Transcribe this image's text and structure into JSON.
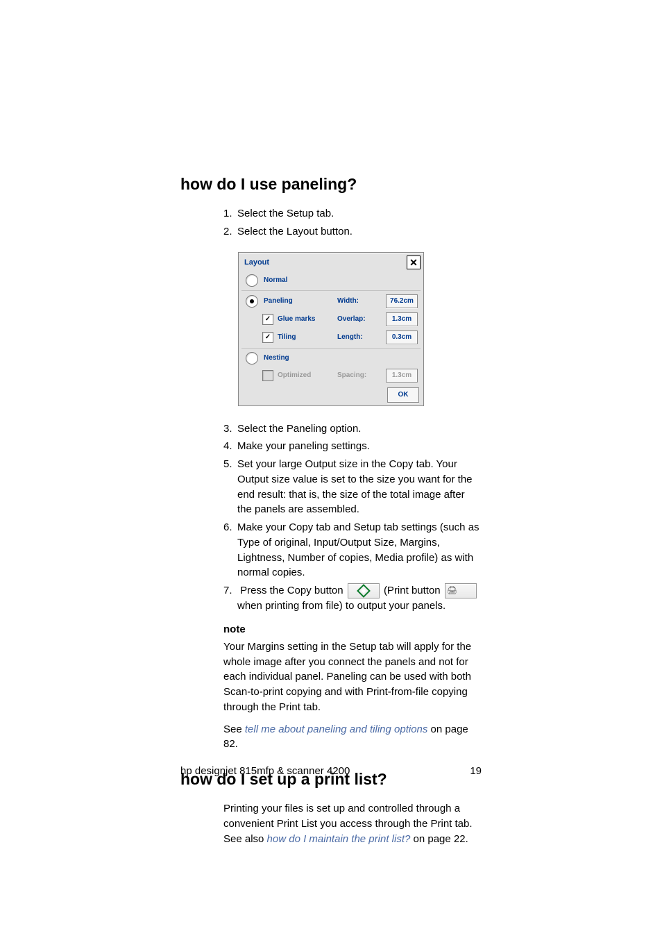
{
  "headings": {
    "h1": "how do I use paneling?",
    "h2": "how do I set up a print list?"
  },
  "steps1": {
    "s1": "Select the Setup tab.",
    "s2": "Select the Layout button."
  },
  "dialog": {
    "title": "Layout",
    "normal": "Normal",
    "paneling": "Paneling",
    "glue_marks": "Glue marks",
    "tiling": "Tiling",
    "nesting": "Nesting",
    "optimized": "Optimized",
    "width_label": "Width:",
    "overlap_label": "Overlap:",
    "length_label": "Length:",
    "spacing_label": "Spacing:",
    "width_val": "76.2cm",
    "overlap_val": "1.3cm",
    "length_val": "0.3cm",
    "spacing_val": "1.3cm",
    "ok": "OK"
  },
  "steps2": {
    "s3": "Select the Paneling option.",
    "s4": "Make your paneling settings.",
    "s5": "Set your large Output size in the Copy tab. Your Output size value is set to the size you want for the end result: that is, the size of the total image after the panels are assembled.",
    "s6": "Make your Copy tab and Setup tab settings (such as Type of original, Input/Output Size, Margins, Lightness, Number of copies, Media profile) as with normal copies.",
    "s7a": "Press the Copy button",
    "s7b": "(Print button",
    "s7c": "when printing from file) to output your panels."
  },
  "note": {
    "label": "note",
    "body": "Your Margins setting in the Setup tab will apply for the whole image after you connect the panels and not for each individual panel. Paneling can be used with both Scan-to-print copying and with Print-from-file copying through the Print tab.",
    "see_pre": "See ",
    "see_link": "tell me about paneling and tiling options",
    "see_post": " on page 82."
  },
  "printlist": {
    "body_pre": "Printing your files is set up and controlled through a convenient Print List you access through the Print tab. See also ",
    "link": "how do I maintain the print list?",
    "body_post": " on page 22."
  },
  "footer": {
    "left": "hp designjet 815mfp & scanner 4200",
    "right": "19"
  }
}
